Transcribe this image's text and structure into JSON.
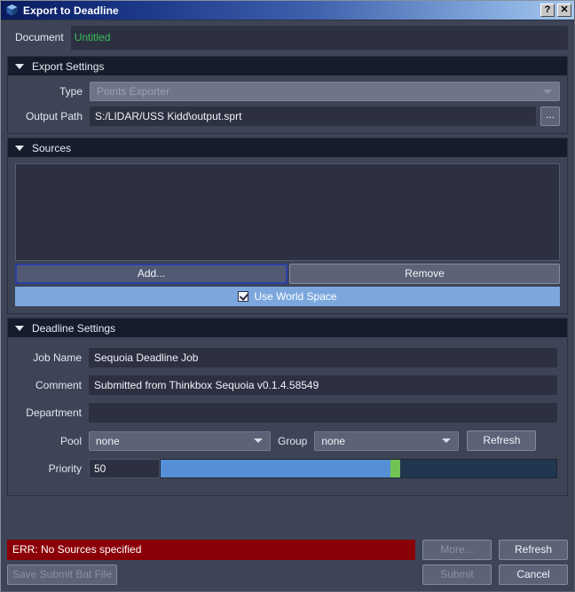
{
  "window": {
    "title": "Export to Deadline",
    "icon": "cube-icon",
    "help_button": "?",
    "close_button": "✕"
  },
  "document": {
    "label": "Document",
    "value": "Untitled",
    "value_color": "#3bbd5c"
  },
  "export_settings": {
    "header": "Export Settings",
    "expanded": true,
    "type": {
      "label": "Type",
      "value": "Points Exporter",
      "disabled": true
    },
    "output_path": {
      "label": "Output Path",
      "value": "S:/LIDAR/USS Kidd\\output.sprt",
      "browse_label": "..."
    }
  },
  "sources": {
    "header": "Sources",
    "expanded": true,
    "items": [],
    "add_label": "Add...",
    "remove_label": "Remove",
    "use_world_space": {
      "label": "Use World Space",
      "checked": true,
      "highlight_color": "#7ba7dd"
    }
  },
  "deadline_settings": {
    "header": "Deadline Settings",
    "expanded": true,
    "job_name": {
      "label": "Job Name",
      "value": "Sequoia Deadline Job"
    },
    "comment": {
      "label": "Comment",
      "value": "Submitted from Thinkbox Sequoia v0.1.4.58549"
    },
    "department": {
      "label": "Department",
      "value": ""
    },
    "pool": {
      "label": "Pool",
      "value": "none"
    },
    "group": {
      "label": "Group",
      "value": "none"
    },
    "refresh_label": "Refresh",
    "priority": {
      "label": "Priority",
      "value": "50",
      "percent": 58,
      "min": 0,
      "max": 100,
      "fill_color": "#5590d6",
      "handle_color": "#72c353",
      "track_color": "#21364f"
    }
  },
  "footer": {
    "error_message": "ERR: No Sources specified",
    "error_color": "#8b0007",
    "more_label": "More...",
    "refresh_label": "Refresh",
    "save_bat_label": "Save Submit Bat File",
    "submit_label": "Submit",
    "cancel_label": "Cancel"
  }
}
